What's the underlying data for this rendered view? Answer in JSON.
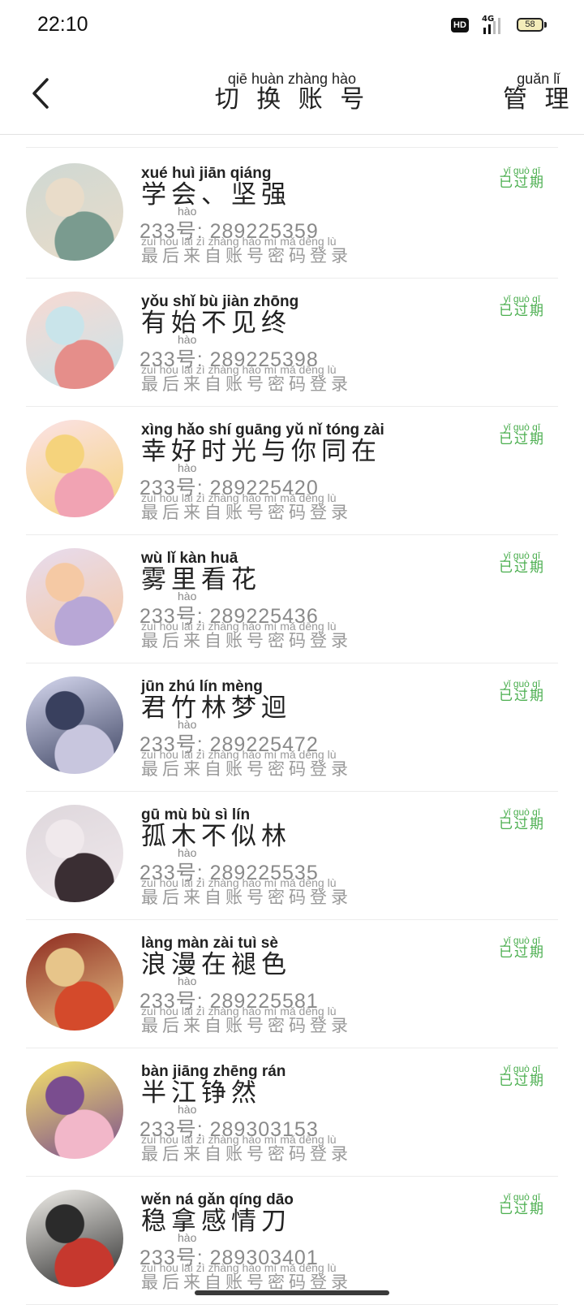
{
  "status": {
    "time": "22:10",
    "hd": "HD",
    "network": "4G",
    "battery": "58"
  },
  "header": {
    "title_pinyin": "qiē huàn zhàng hào",
    "title": "切 换 账 号",
    "manage_pinyin": "guǎn  lǐ",
    "manage": "管 理"
  },
  "labels": {
    "hao_pinyin": "hào",
    "login_pinyin": "zuì hòu lái  zì zhàng hào mì  mǎ dēng lù",
    "login_text": "最后来自账号密码登录",
    "expired_pinyin": "yǐ guò qī",
    "expired_text": "已过期"
  },
  "accounts": [
    {
      "name_pinyin": "xué huì    jiān qiáng",
      "name": "学会、坚强",
      "account": "233号: 289225359",
      "colors": [
        "#cfd8d3",
        "#e9dcc9",
        "#7a9b8f"
      ]
    },
    {
      "name_pinyin": "yǒu shǐ  bù  jiàn zhōng",
      "name": "有始不见终",
      "account": "233号: 289225398",
      "colors": [
        "#f7d9d2",
        "#c9e4ea",
        "#e58e8a"
      ]
    },
    {
      "name_pinyin": "xìng hǎo shí guāng yǔ  nǐ  tóng zài",
      "name": "幸好时光与你同在",
      "account": "233号: 289225420",
      "colors": [
        "#fbe2e7",
        "#f5d37c",
        "#f1a3b3"
      ]
    },
    {
      "name_pinyin": "wù  lǐ  kàn huā",
      "name": "雾里看花",
      "account": "233号: 289225436",
      "colors": [
        "#e7dcef",
        "#f5c9a4",
        "#b8a7d6"
      ]
    },
    {
      "name_pinyin": "jūn zhú lín mèng",
      "name": "君竹林梦迴",
      "account": "233号: 289225472",
      "colors": [
        "#d7d9f0",
        "#39405e",
        "#c8c6de"
      ]
    },
    {
      "name_pinyin": "gū  mù  bù  sì  lín",
      "name": "孤木不似林",
      "account": "233号: 289225535",
      "colors": [
        "#ded7dc",
        "#f0e9ec",
        "#3a2e33"
      ]
    },
    {
      "name_pinyin": "làng màn zài tuì  sè",
      "name": "浪漫在褪色",
      "account": "233号: 289225581",
      "colors": [
        "#8e2a1e",
        "#e7c58a",
        "#d44a2b"
      ]
    },
    {
      "name_pinyin": "bàn jiāng zhēng rán",
      "name": "半江铮然",
      "account": "233号: 289303153",
      "colors": [
        "#f6e26a",
        "#7a4d8f",
        "#f2b7c9"
      ]
    },
    {
      "name_pinyin": "wěn ná  gǎn qíng dāo",
      "name": "稳拿感情刀",
      "account": "233号: 289303401",
      "colors": [
        "#f1efea",
        "#2b2b2b",
        "#c6382e"
      ]
    }
  ]
}
